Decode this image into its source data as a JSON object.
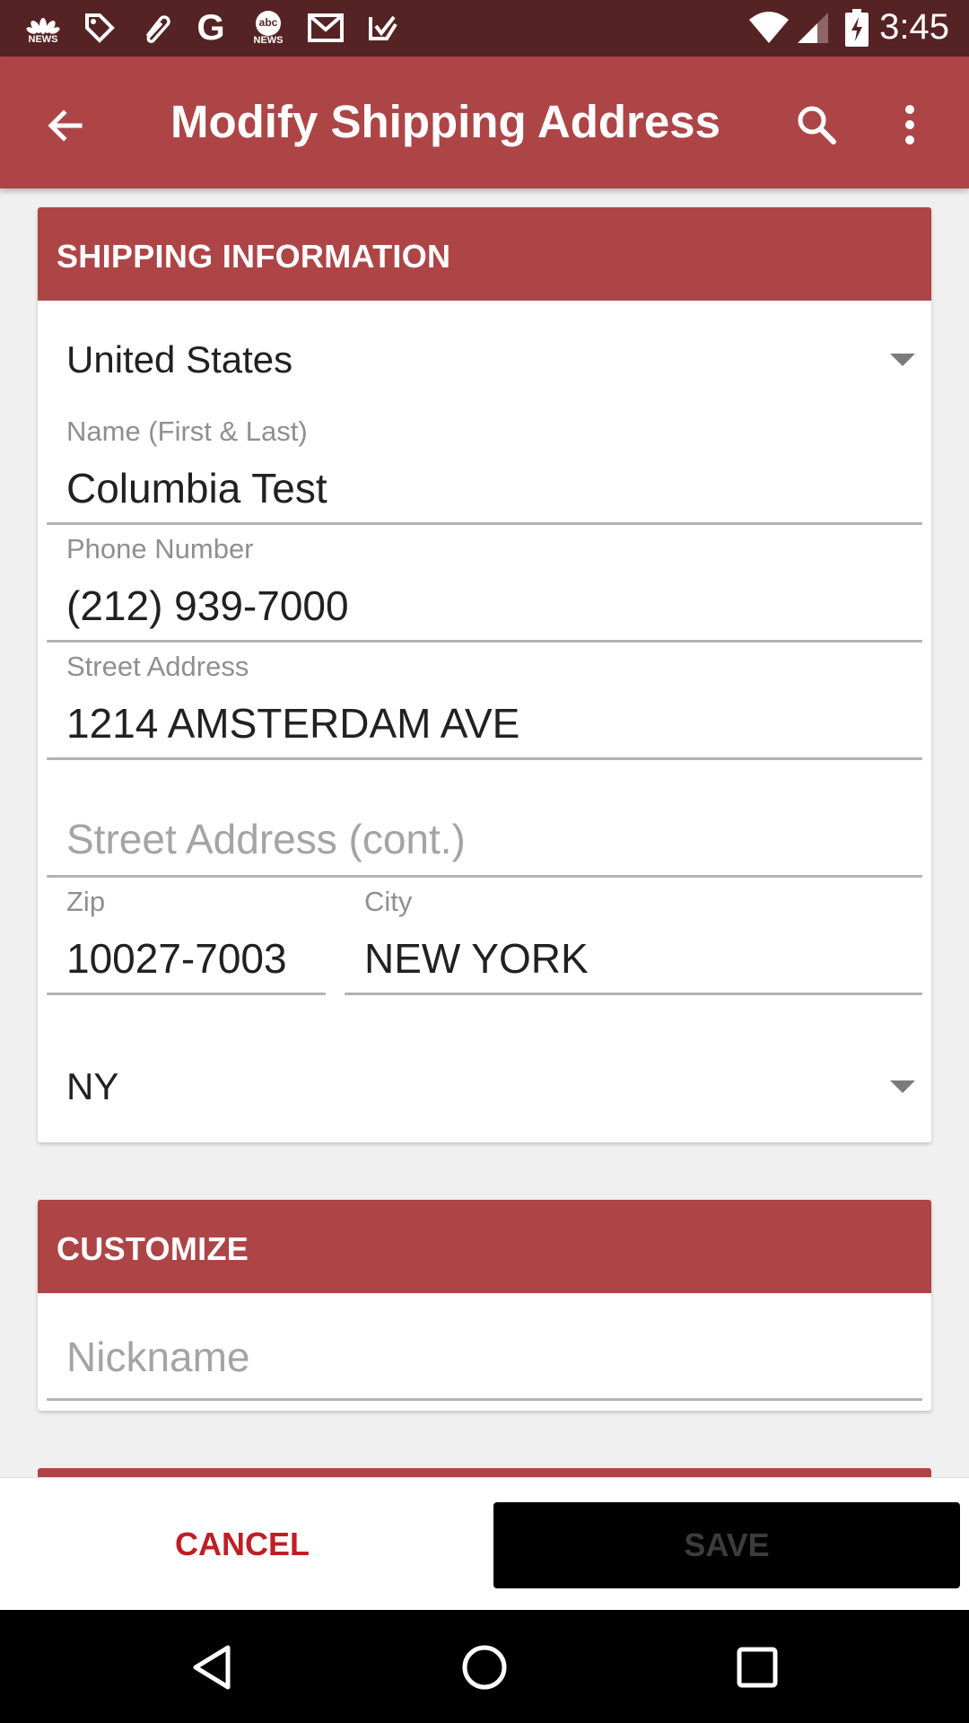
{
  "status_bar": {
    "time": "3:45",
    "left_icons": [
      "nbc-news-icon",
      "tag-icon",
      "paperclip-icon",
      "google-icon",
      "abc-news-icon",
      "gmail-icon",
      "check-icon"
    ],
    "news_label": "NEWS",
    "abc_label": "abc"
  },
  "app_bar": {
    "title": "Modify Shipping Address",
    "colors": {
      "primary": "#ad4547",
      "status": "#562325"
    }
  },
  "shipping": {
    "header": "SHIPPING INFORMATION",
    "country": "United States",
    "name_label": "Name (First & Last)",
    "name_value": "Columbia Test",
    "phone_label": "Phone Number",
    "phone_value": "(212) 939-7000",
    "street_label": "Street Address",
    "street_value": "1214 AMSTERDAM AVE",
    "street2_placeholder": "Street Address (cont.)",
    "zip_label": "Zip",
    "zip_value": "10027-7003",
    "city_label": "City",
    "city_value": "NEW YORK",
    "state": "NY"
  },
  "customize": {
    "header": "CUSTOMIZE",
    "nickname_placeholder": "Nickname"
  },
  "actions": {
    "cancel": "CANCEL",
    "save": "SAVE"
  }
}
